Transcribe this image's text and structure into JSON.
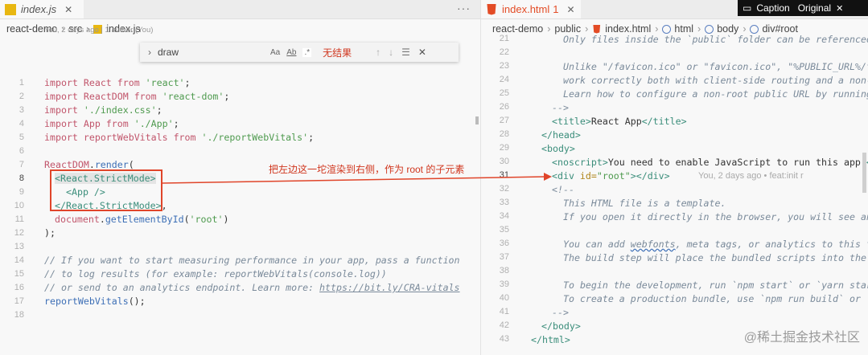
{
  "left": {
    "tab": {
      "name": "index.js"
    },
    "breadcrumb": [
      "react-demo",
      "src",
      "index.js"
    ],
    "blame": "You, 2 days ago | 1 author (You)",
    "find": {
      "query": "draw",
      "opt_case": "Aa",
      "opt_word": "Ab",
      "opt_regex": ".*",
      "result": "无结果"
    },
    "annotation": "把左边这一坨渲染到右侧，作为 root 的子元素",
    "line_numbers": [
      "1",
      "2",
      "3",
      "4",
      "5",
      "6",
      "7",
      "8",
      "9",
      "10",
      "11",
      "12",
      "13",
      "14",
      "15",
      "16",
      "17",
      "18"
    ]
  },
  "right": {
    "tab": {
      "name": "index.html",
      "count": "1"
    },
    "breadcrumb": [
      "react-demo",
      "public",
      "index.html",
      "html",
      "body",
      "div#root"
    ],
    "line_numbers": [
      "21",
      "22",
      "23",
      "24",
      "25",
      "26",
      "27",
      "28",
      "29",
      "30",
      "31",
      "32",
      "33",
      "34",
      "35",
      "36",
      "37",
      "38",
      "39",
      "40",
      "41",
      "42",
      "43"
    ],
    "blame": "You, 2 days ago • feat:init r"
  },
  "overlay": {
    "caption": "Caption",
    "original": "Original"
  },
  "watermark": "@稀土掘金技术社区"
}
